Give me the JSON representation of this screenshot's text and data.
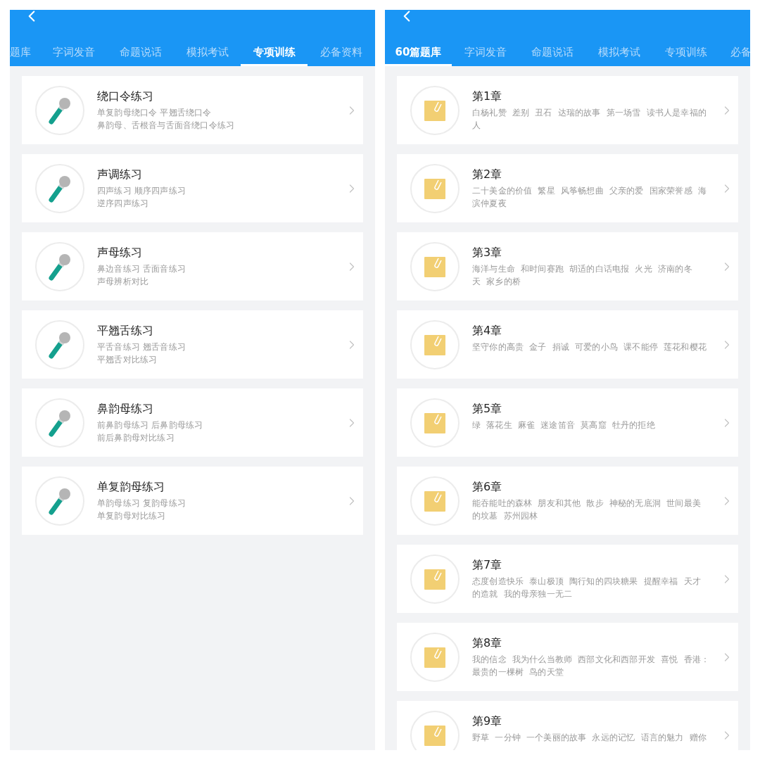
{
  "screens": [
    {
      "tabs": [
        {
          "label": "题库",
          "selected": false,
          "kind": "clipped_left"
        },
        {
          "label": "字词发音",
          "selected": false
        },
        {
          "label": "命题说话",
          "selected": false
        },
        {
          "label": "模拟考试",
          "selected": false
        },
        {
          "label": "专项训练",
          "selected": true
        },
        {
          "label": "必备资料",
          "selected": false
        }
      ],
      "items": [
        {
          "kind": "mic",
          "title": "绕口令练习",
          "lines": [
            "单复韵母绕口令 平翘舌绕口令",
            "鼻韵母、舌根音与舌面音绕口令练习"
          ]
        },
        {
          "kind": "mic",
          "title": "声调练习",
          "lines": [
            "四声练习 顺序四声练习",
            "逆序四声练习"
          ]
        },
        {
          "kind": "mic",
          "title": "声母练习",
          "lines": [
            "鼻边音练习 舌面音练习",
            "声母辨析对比"
          ]
        },
        {
          "kind": "mic",
          "title": "平翘舌练习",
          "lines": [
            "平舌音练习 翘舌音练习",
            "平翘舌对比练习"
          ]
        },
        {
          "kind": "mic",
          "title": "鼻韵母练习",
          "lines": [
            "前鼻韵母练习 后鼻韵母练习",
            "前后鼻韵母对比练习"
          ]
        },
        {
          "kind": "mic",
          "title": "单复韵母练习",
          "lines": [
            "单韵母练习 复韵母练习",
            "单复韵母对比练习"
          ]
        }
      ]
    },
    {
      "tabs": [
        {
          "label": "60篇题库",
          "selected": true
        },
        {
          "label": "字词发音",
          "selected": false
        },
        {
          "label": "命题说话",
          "selected": false
        },
        {
          "label": "模拟考试",
          "selected": false
        },
        {
          "label": "专项训练",
          "selected": false
        },
        {
          "label": "必备",
          "selected": false,
          "kind": "clipped_right"
        }
      ],
      "items": [
        {
          "kind": "folder",
          "title": "第1章",
          "lines": [
            "白杨礼赞  差别  丑石  达瑞的故事  第一场雪  读书人是幸福的",
            "人"
          ]
        },
        {
          "kind": "folder",
          "title": "第2章",
          "lines": [
            "二十美金的价值  繁星  风筝畅想曲  父亲的爱  国家荣誉感  海",
            "滨仲夏夜"
          ]
        },
        {
          "kind": "folder",
          "title": "第3章",
          "lines": [
            "海洋与生命  和时间赛跑  胡适的白话电报  火光  济南的冬",
            "天  家乡的桥"
          ]
        },
        {
          "kind": "folder",
          "title": "第4章",
          "lines": [
            "坚守你的高贵  金子  捐诚  可爱的小鸟  课不能停  莲花和樱花"
          ]
        },
        {
          "kind": "folder",
          "title": "第5章",
          "lines": [
            "绿  落花生  麻雀  迷途笛音  莫高窟  牡丹的拒绝"
          ]
        },
        {
          "kind": "folder",
          "title": "第6章",
          "lines": [
            "能吞能吐的森林  朋友和其他  散步  神秘的无底洞  世间最美",
            "的坟墓  苏州园林"
          ]
        },
        {
          "kind": "folder",
          "title": "第7章",
          "lines": [
            "态度创造快乐  泰山极顶  陶行知的四块糖果  提醒幸福  天才",
            "的造就  我的母亲独一无二"
          ]
        },
        {
          "kind": "folder",
          "title": "第8章",
          "lines": [
            "我的信念  我为什么当教师  西部文化和西部开发  喜悦  香港：",
            "最贵的一棵树  鸟的天堂"
          ]
        },
        {
          "kind": "folder",
          "title": "第9章",
          "lines": [
            "野草  一分钟  一个美丽的故事  永远的记忆  语言的魅力  赠你"
          ]
        }
      ]
    }
  ]
}
